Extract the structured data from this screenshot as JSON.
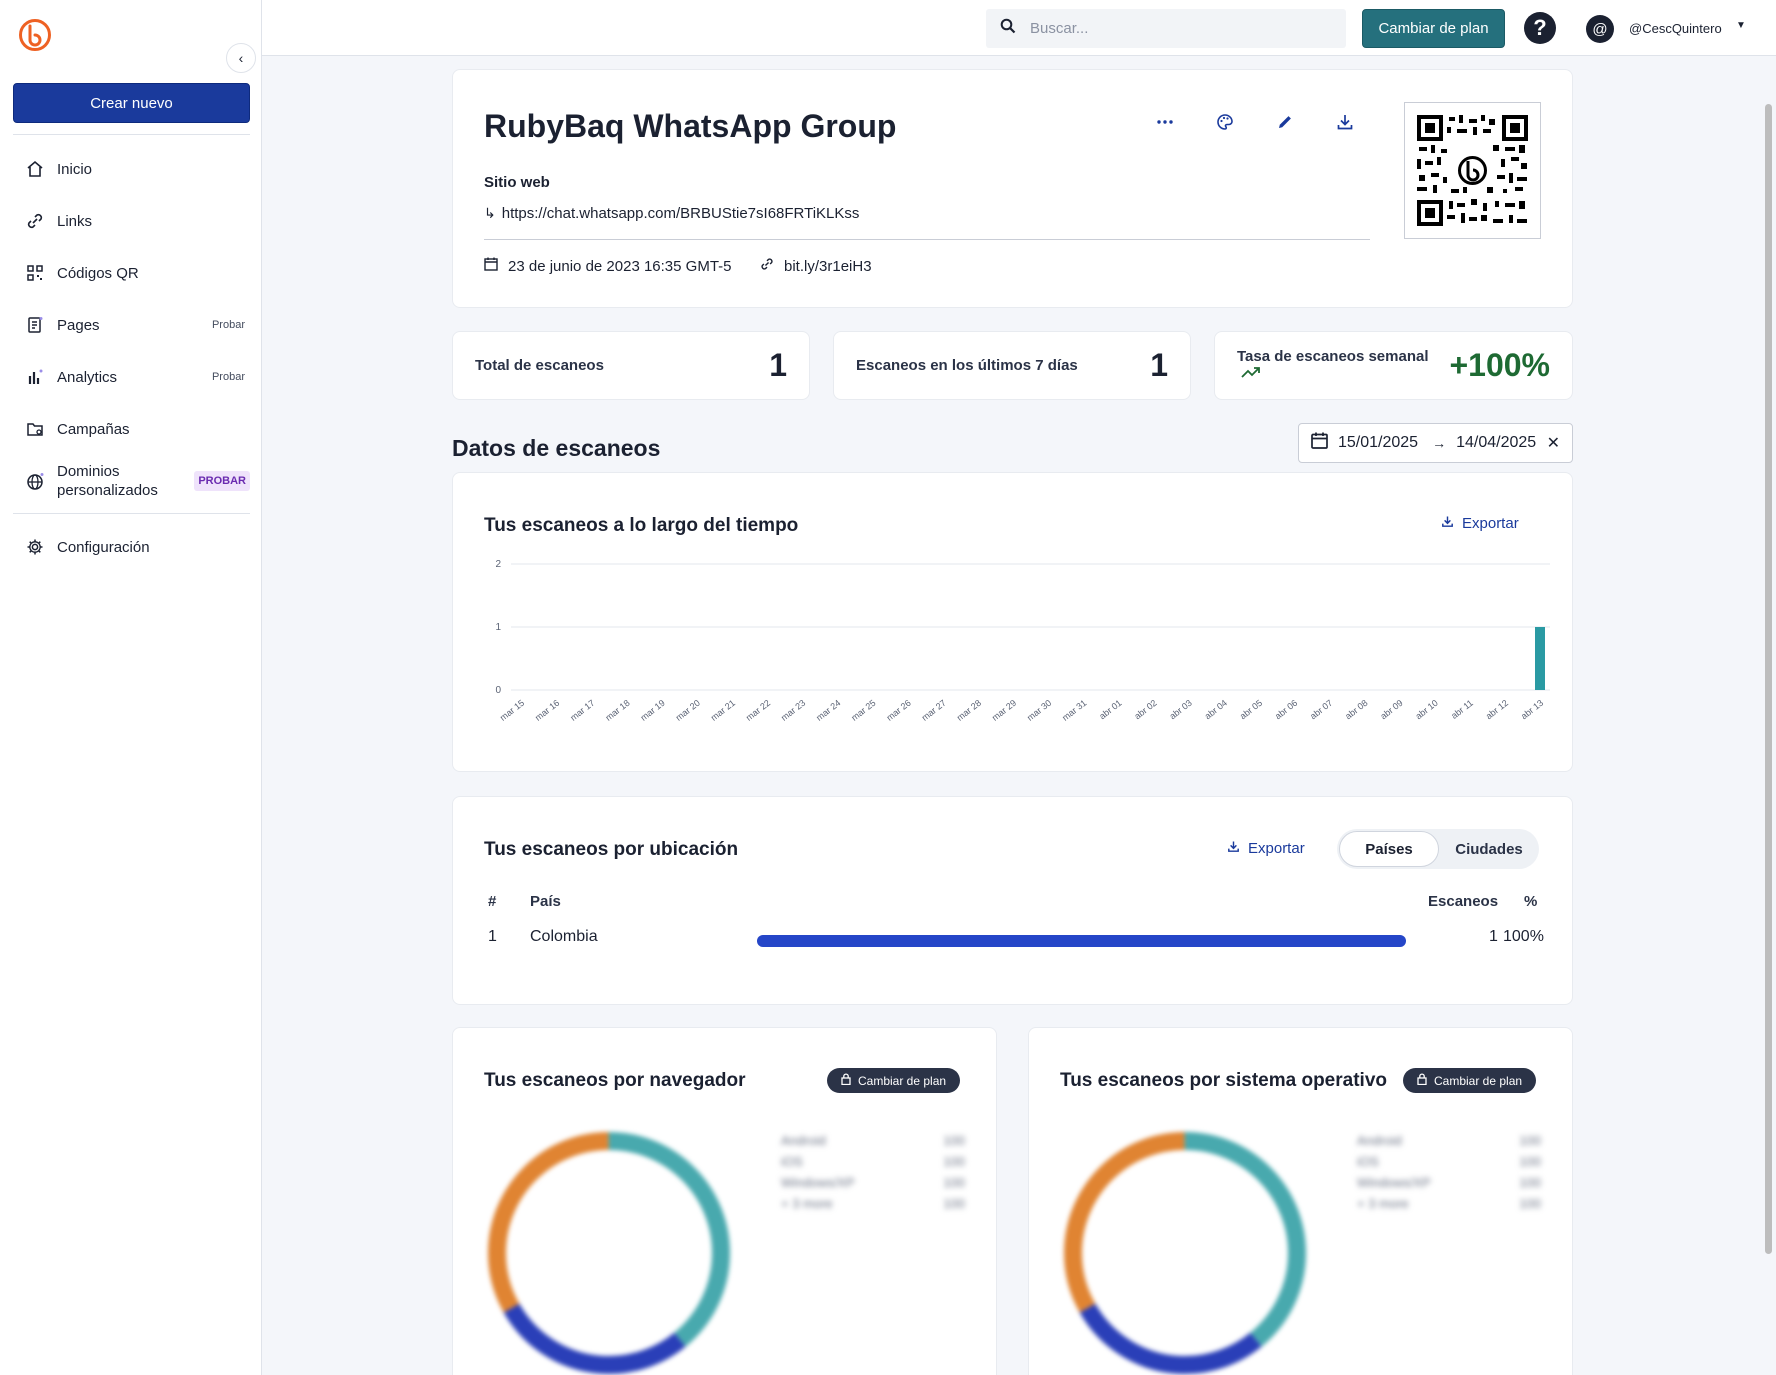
{
  "sidebar": {
    "create_label": "Crear nuevo",
    "items": [
      {
        "label": "Inicio",
        "icon": "home-icon"
      },
      {
        "label": "Links",
        "icon": "link-icon"
      },
      {
        "label": "Códigos QR",
        "icon": "qr-code-icon"
      },
      {
        "label": "Pages",
        "icon": "pages-icon",
        "tag": "Probar"
      },
      {
        "label": "Analytics",
        "icon": "analytics-icon",
        "tag": "Probar"
      },
      {
        "label": "Campañas",
        "icon": "campaigns-icon"
      },
      {
        "label_line1": "Dominios",
        "label_line2": "personalizados",
        "icon": "globe-icon",
        "tag": "PROBAR"
      },
      {
        "label": "Configuración",
        "icon": "gear-icon"
      }
    ]
  },
  "topbar": {
    "search_placeholder": "Buscar...",
    "upgrade_label": "Cambiar de plan",
    "help_symbol": "?",
    "avatar_symbol": "@",
    "username": "@CescQuintero"
  },
  "qr_detail": {
    "title": "RubyBaq WhatsApp Group",
    "site_label": "Sitio web",
    "url": "https://chat.whatsapp.com/BRBUStie7sI68FRTiKLKss",
    "created": "23 de junio de 2023 16:35 GMT-5",
    "short_link": "bit.ly/3r1eiH3"
  },
  "stats": [
    {
      "label": "Total de escaneos",
      "value": "1"
    },
    {
      "label": "Escaneos en los últimos 7 días",
      "value": "1"
    },
    {
      "label": "Tasa de escaneos semanal",
      "value": "+100%"
    }
  ],
  "scan_data": {
    "heading": "Datos de escaneos",
    "date_from": "15/01/2025",
    "date_to": "14/04/2025"
  },
  "time_chart": {
    "title": "Tus escaneos a lo largo del tiempo",
    "export_label": "Exportar"
  },
  "chart_data": {
    "type": "bar",
    "categories": [
      "mar 15",
      "mar 16",
      "mar 17",
      "mar 18",
      "mar 19",
      "mar 20",
      "mar 21",
      "mar 22",
      "mar 23",
      "mar 24",
      "mar 25",
      "mar 26",
      "mar 27",
      "mar 28",
      "mar 29",
      "mar 30",
      "mar 31",
      "abr 01",
      "abr 02",
      "abr 03",
      "abr 04",
      "abr 05",
      "abr 06",
      "abr 07",
      "abr 08",
      "abr 09",
      "abr 10",
      "abr 11",
      "abr 12",
      "abr 13"
    ],
    "values": [
      0,
      0,
      0,
      0,
      0,
      0,
      0,
      0,
      0,
      0,
      0,
      0,
      0,
      0,
      0,
      0,
      0,
      0,
      0,
      0,
      0,
      0,
      0,
      0,
      0,
      0,
      0,
      0,
      0,
      1
    ],
    "yticks": [
      "0",
      "1",
      "2"
    ],
    "ylim": [
      0,
      2
    ],
    "grid": true,
    "color": "#2a9aa3"
  },
  "location": {
    "title": "Tus escaneos por ubicación",
    "export_label": "Exportar",
    "tab_active": "Países",
    "tab_inactive": "Ciudades",
    "headers": {
      "rank": "#",
      "country": "País",
      "scans": "Escaneos",
      "pct": "%"
    },
    "rows": [
      {
        "rank": "1",
        "country": "Colombia",
        "scans": "1",
        "pct": "100%",
        "share": 1.0
      }
    ]
  },
  "browser": {
    "title": "Tus escaneos por navegador",
    "lock_label": "Cambiar de plan",
    "legend": [
      {
        "name": "Android",
        "value": "100"
      },
      {
        "name": "iOS",
        "value": "100"
      },
      {
        "name": "Windows/XP",
        "value": "100"
      },
      {
        "name": "+ 3 more",
        "value": "100"
      }
    ]
  },
  "os": {
    "title": "Tus escaneos por sistema operativo",
    "lock_label": "Cambiar de plan",
    "legend": [
      {
        "name": "Android",
        "value": "100"
      },
      {
        "name": "iOS",
        "value": "100"
      },
      {
        "name": "Windows/XP",
        "value": "100"
      },
      {
        "name": "+ 3 more",
        "value": "100"
      }
    ]
  },
  "colors": {
    "primary": "#1a3a9c",
    "upgrade": "#25707d",
    "positive": "#1e6a33",
    "donut_teal": "#48a9ae",
    "donut_blue": "#2a3fb8",
    "donut_orange": "#e08432",
    "brand_orange": "#ee6123"
  }
}
